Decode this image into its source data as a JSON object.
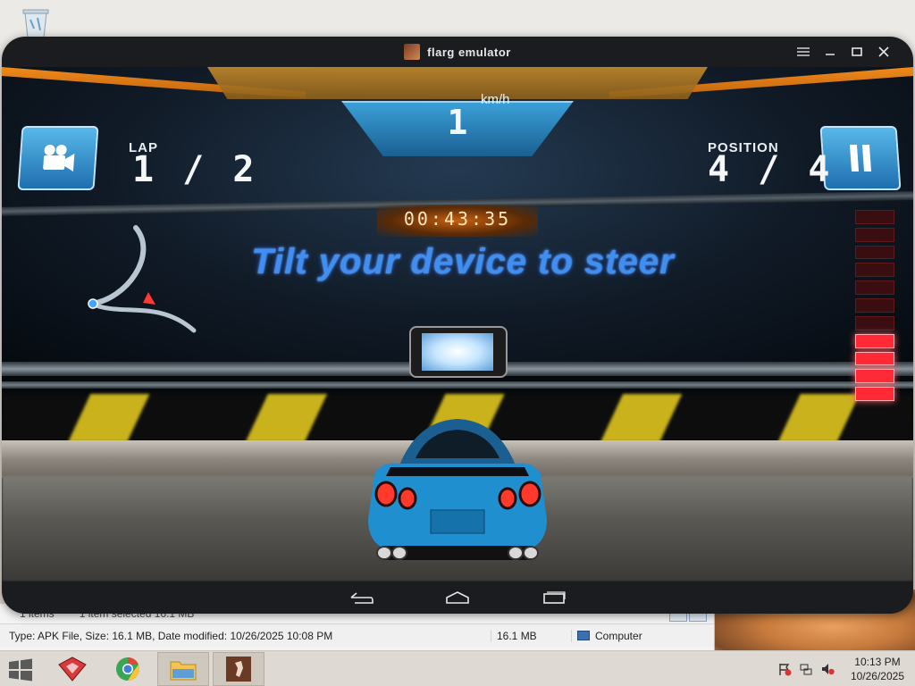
{
  "emulator": {
    "title": "flarg emulator",
    "controls": [
      "menu-icon",
      "minimize-icon",
      "maximize-icon",
      "close-icon"
    ]
  },
  "game": {
    "lap_label": "LAP",
    "lap_value": "1 / 2",
    "position_label": "POSITION",
    "position_value": "4 / 4",
    "speed_unit": "km/h",
    "speed_value": "1",
    "timer": "00:43:35",
    "hint": "Tilt your device to steer",
    "rev_meter_total_segments": 11,
    "rev_meter_lit_segments": 4
  },
  "android_nav": [
    "back-icon",
    "home-icon",
    "recents-icon"
  ],
  "explorer": {
    "items_count": "1 items",
    "items_selected": "1 item selected 16.1 MB",
    "status_type": "Type: APK File, Size: 16.1 MB, Date modified: 10/26/2025 10:08 PM",
    "status_size": "16.1 MB",
    "status_location": "Computer"
  },
  "taskbar": {
    "apps": [
      "start-button",
      "bluestacks-app",
      "chrome-app",
      "file-explorer-app",
      "emulator-app"
    ],
    "time": "10:13 PM",
    "date": "10/26/2025"
  },
  "colors": {
    "hud_blue": "#3aa0d8",
    "hud_orange": "#f08a1a",
    "hint_blue": "#3f8ef0",
    "rev_red": "#ff2a35",
    "car_blue": "#1f8fd0"
  }
}
